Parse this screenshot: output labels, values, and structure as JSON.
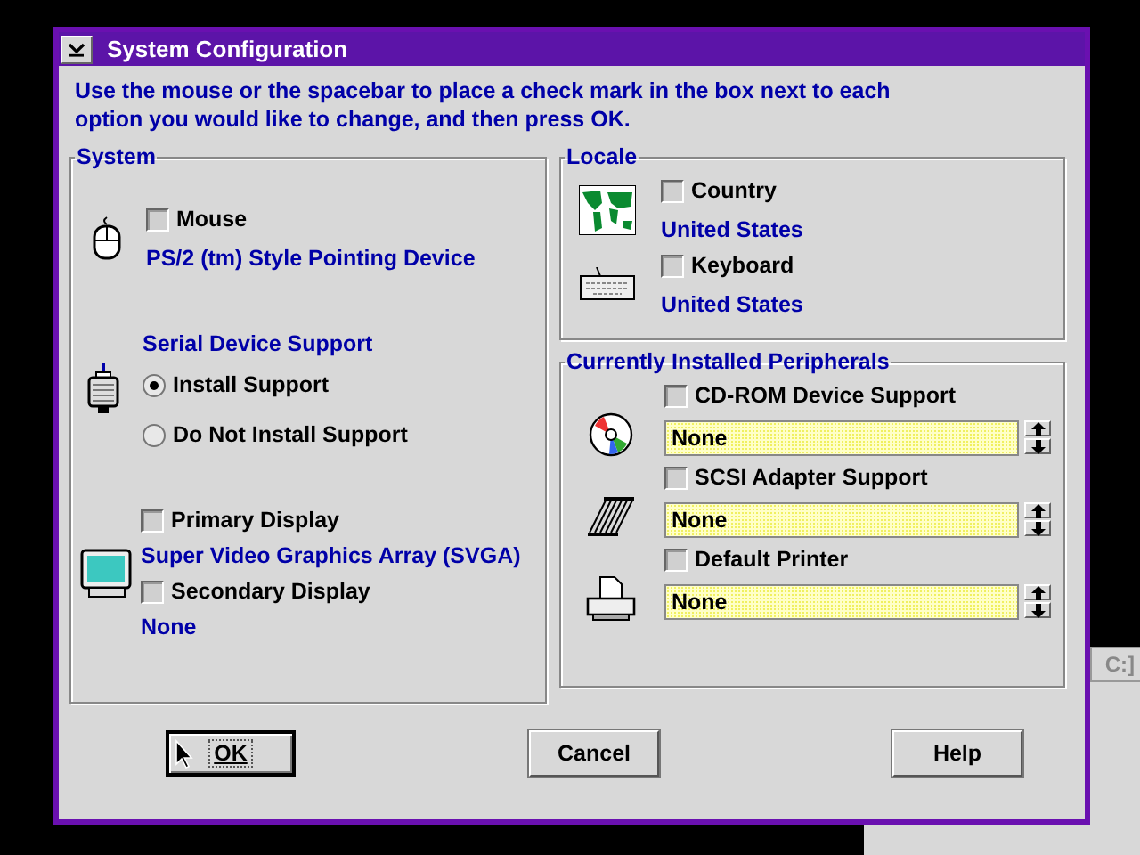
{
  "window": {
    "title": "System Configuration"
  },
  "instructions": "Use the mouse or the spacebar to place a check mark in the box next to each option you would like to change, and then press OK.",
  "system": {
    "title": "System",
    "mouse": {
      "label": "Mouse",
      "checked": false,
      "value": "PS/2 (tm) Style Pointing Device"
    },
    "serial": {
      "title": "Serial Device Support",
      "options": [
        {
          "label": "Install Support",
          "selected": true
        },
        {
          "label": "Do Not Install Support",
          "selected": false
        }
      ]
    },
    "displays": [
      {
        "label": "Primary Display",
        "checked": false,
        "value": "Super Video Graphics Array (SVGA)"
      },
      {
        "label": "Secondary Display",
        "checked": false,
        "value": "None"
      }
    ]
  },
  "locale": {
    "title": "Locale",
    "items": [
      {
        "label": "Country",
        "checked": false,
        "value": "United States"
      },
      {
        "label": "Keyboard",
        "checked": false,
        "value": "United States"
      }
    ]
  },
  "peripherals": {
    "title": "Currently Installed Peripherals",
    "items": [
      {
        "label": "CD-ROM Device Support",
        "checked": false,
        "value": "None"
      },
      {
        "label": "SCSI Adapter Support",
        "checked": false,
        "value": "None"
      },
      {
        "label": "Default Printer",
        "checked": false,
        "value": "None"
      }
    ]
  },
  "buttons": [
    {
      "label": "OK",
      "default": true
    },
    {
      "label": "Cancel",
      "default": false
    },
    {
      "label": "Help",
      "default": false
    }
  ],
  "background_window": {
    "button": "C:]"
  }
}
